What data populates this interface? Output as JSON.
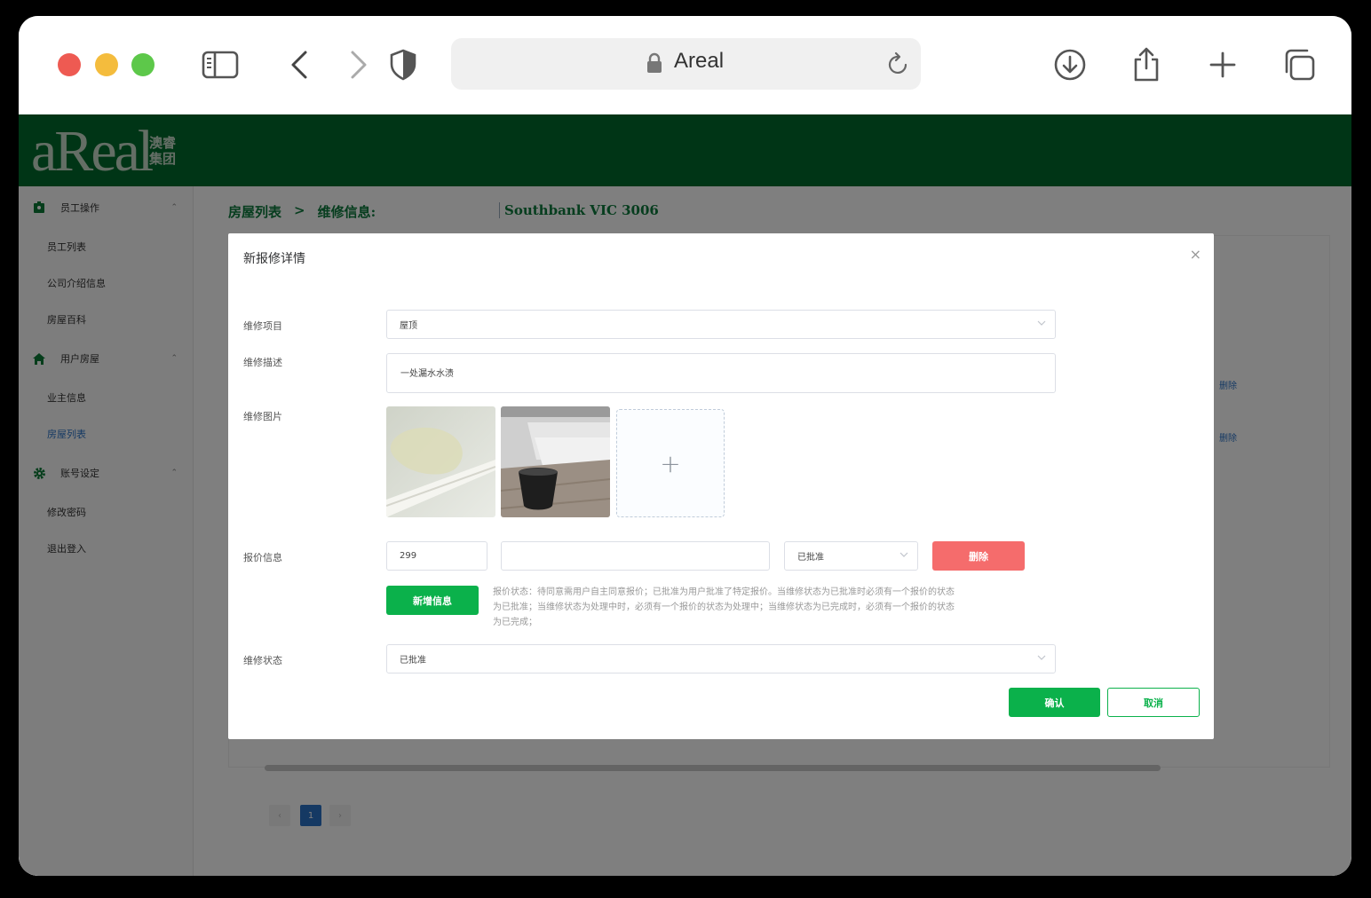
{
  "browser": {
    "url_text": "Areal"
  },
  "app": {
    "logo_text": "aReal",
    "logo_cn_line1": "澳睿",
    "logo_cn_line2": "集团",
    "brand_color": "#016b2c"
  },
  "sidebar": {
    "groups": [
      {
        "label": "员工操作",
        "icon": "badge-icon",
        "items": [
          "员工列表",
          "公司介绍信息",
          "房屋百科"
        ]
      },
      {
        "label": "用户房屋",
        "icon": "home-icon",
        "items": [
          "业主信息",
          "房屋列表"
        ]
      },
      {
        "label": "账号设定",
        "icon": "gear-icon",
        "items": [
          "修改密码",
          "退出登入"
        ]
      }
    ],
    "active_item": "房屋列表"
  },
  "breadcrumb": {
    "home": "房屋列表",
    "separator": ">",
    "current": "维修信息:",
    "address": "Southbank VIC 3006"
  },
  "background_table": {
    "delete_labels": [
      "删除",
      "删除"
    ]
  },
  "pagination": {
    "prev": "‹",
    "page": "1",
    "next": "›"
  },
  "modal": {
    "title": "新报修详情",
    "close": "×",
    "fields": {
      "item_label": "维修项目",
      "item_value": "屋顶",
      "desc_label": "维修描述",
      "desc_value": "一处漏水水渍",
      "images_label": "维修图片",
      "quote_label": "报价信息",
      "quote_amount": "299",
      "quote_note": "",
      "quote_status": "已批准",
      "delete_button": "删除",
      "add_button": "新增信息",
      "hint": "报价状态：待同意需用户自主同意报价；已批准为用户批准了特定报价。当维修状态为已批准时必须有一个报价的状态为已批准；当维修状态为处理中时，必须有一个报价的状态为处理中；当维修状态为已完成时，必须有一个报价的状态为已完成；",
      "status_label": "维修状态",
      "status_value": "已批准"
    },
    "confirm_button": "确认",
    "cancel_button": "取消"
  }
}
